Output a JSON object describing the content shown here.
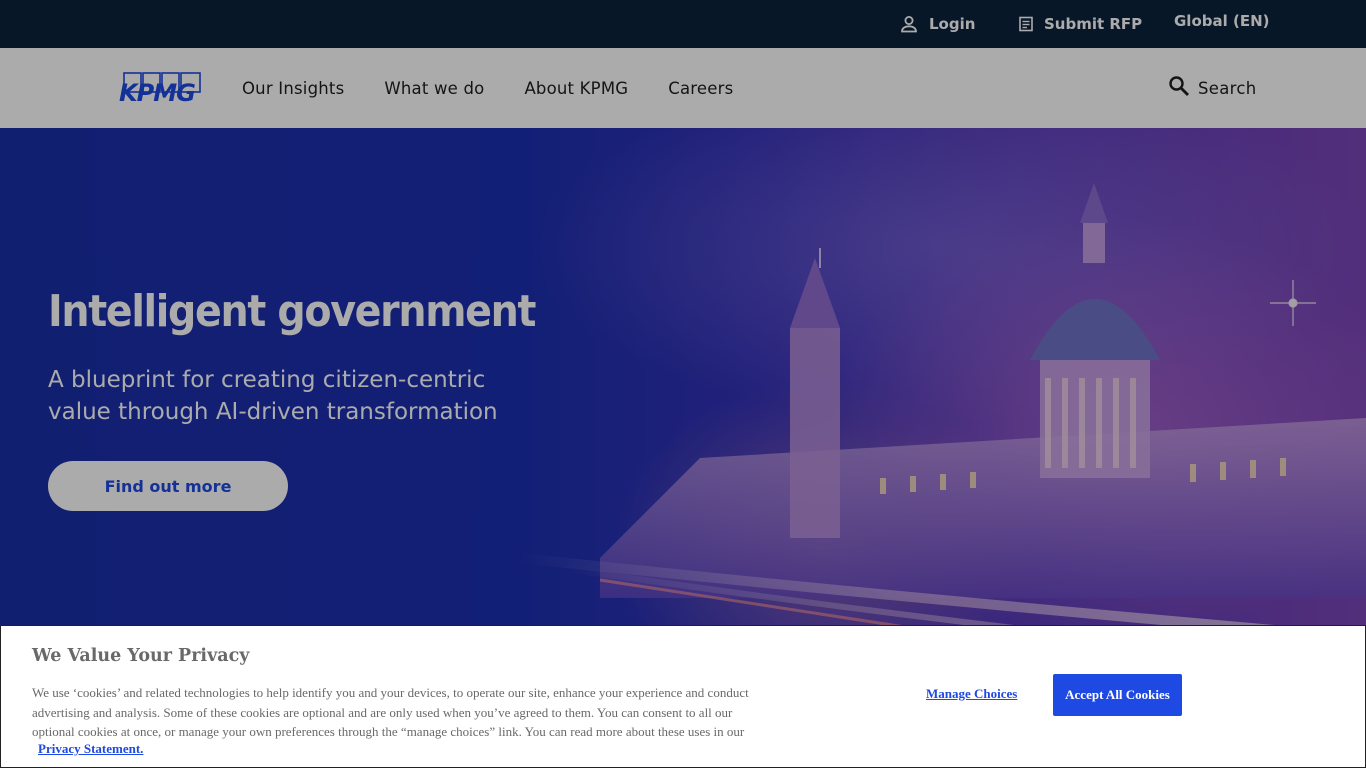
{
  "utility": {
    "login": "Login",
    "submit_rfp": "Submit RFP",
    "global": "Global (EN)"
  },
  "nav": {
    "logo_text": "KPMG",
    "links": [
      "Our Insights",
      "What we do",
      "About KPMG",
      "Careers"
    ],
    "search": "Search"
  },
  "hero": {
    "title": "Intelligent government",
    "subtitle": "A blueprint for creating citizen-centric value through AI-driven transformation",
    "cta": "Find out more"
  },
  "cookie": {
    "title": "We Value Your Privacy",
    "body": "We use ‘cookies’ and related technologies to help identify you and your devices, to operate our site, enhance your experience and conduct advertising and analysis. Some of these cookies are optional and are only used when you’ve agreed to them. You can consent to all our optional cookies at once, or manage your own preferences through the “manage choices” link. You can read more about these uses in our",
    "privacy_link": "Privacy Statement.",
    "manage_choices": "Manage Choices",
    "accept_all": "Accept All Cookies"
  },
  "colors": {
    "brand_blue": "#1e49e2",
    "utility_bg": "#0c233c",
    "hero_blue": "#1c2fb0"
  },
  "icons": [
    "person-icon",
    "document-icon",
    "search-icon"
  ]
}
